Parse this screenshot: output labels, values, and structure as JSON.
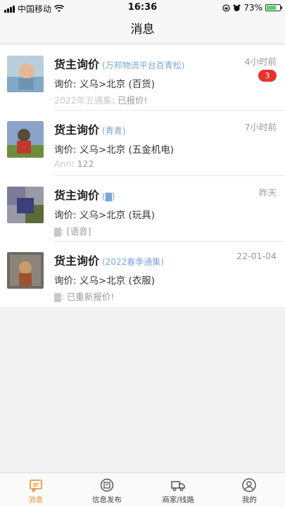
{
  "status_bar": {
    "carrier": "中国移动",
    "time": "16:36",
    "battery": "73%"
  },
  "header": {
    "title": "消息"
  },
  "messages": [
    {
      "title": "货主询价",
      "sender": "(万邦物流平台百青松)",
      "route": "询价: 义乌>北京 (百货)",
      "last_sender": "2022年五通集",
      "last_text": ": 已报价!",
      "time": "4小时前",
      "badge": "3"
    },
    {
      "title": "货主询价",
      "sender": "(青青)",
      "route": "询价: 义乌>北京 (五金机电)",
      "last_sender": "Ann",
      "last_text": ": 122",
      "time": "7小时前",
      "badge": ""
    },
    {
      "title": "货主询价",
      "sender": "(▇)",
      "route": "询价: 义乌>北京 (玩具)",
      "last_sender": "▇",
      "last_text": ": [语音]",
      "time": "昨天",
      "badge": ""
    },
    {
      "title": "货主询价",
      "sender": "(2022春季通集)",
      "route": "询价: 义乌>北京 (衣服)",
      "last_sender": "▇",
      "last_text": ": 已重新报价!",
      "time": "22-01-04",
      "badge": ""
    }
  ],
  "tabs": [
    {
      "label": "消息",
      "icon": "message-icon"
    },
    {
      "label": "信息发布",
      "icon": "publish-icon"
    },
    {
      "label": "商家/线路",
      "icon": "truck-icon"
    },
    {
      "label": "我的",
      "icon": "profile-icon"
    }
  ],
  "colors": {
    "accent": "#f08a24",
    "badge": "#e8322e",
    "sender": "#7aa6d6"
  }
}
